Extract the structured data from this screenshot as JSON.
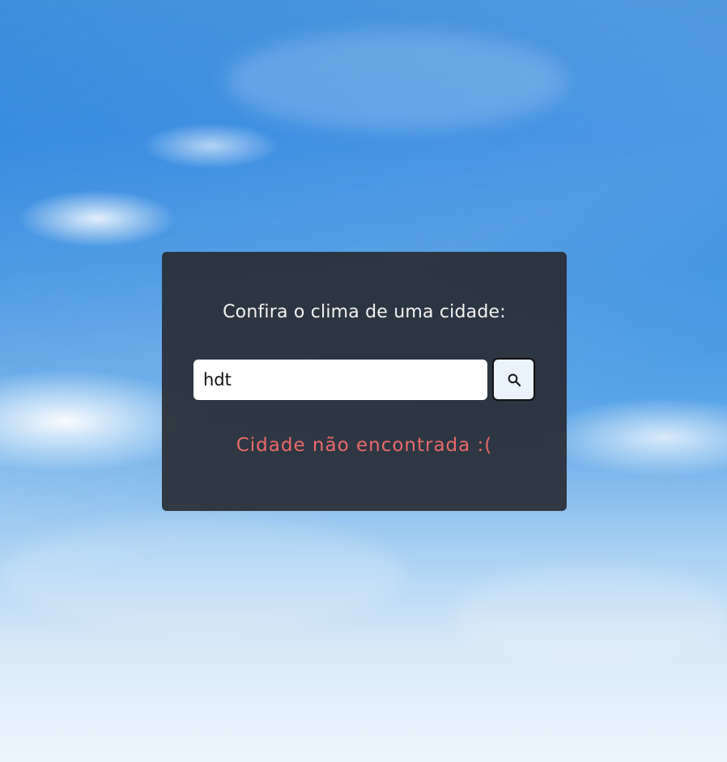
{
  "card": {
    "title": "Confira o clima de uma cidade:"
  },
  "search": {
    "value": "hdt",
    "button_icon": "search-icon"
  },
  "status": {
    "error": "Cidade não encontrada :("
  },
  "colors": {
    "card_background": "#282c34",
    "error": "#ea6a6a",
    "button_background": "#eaf2fb"
  }
}
